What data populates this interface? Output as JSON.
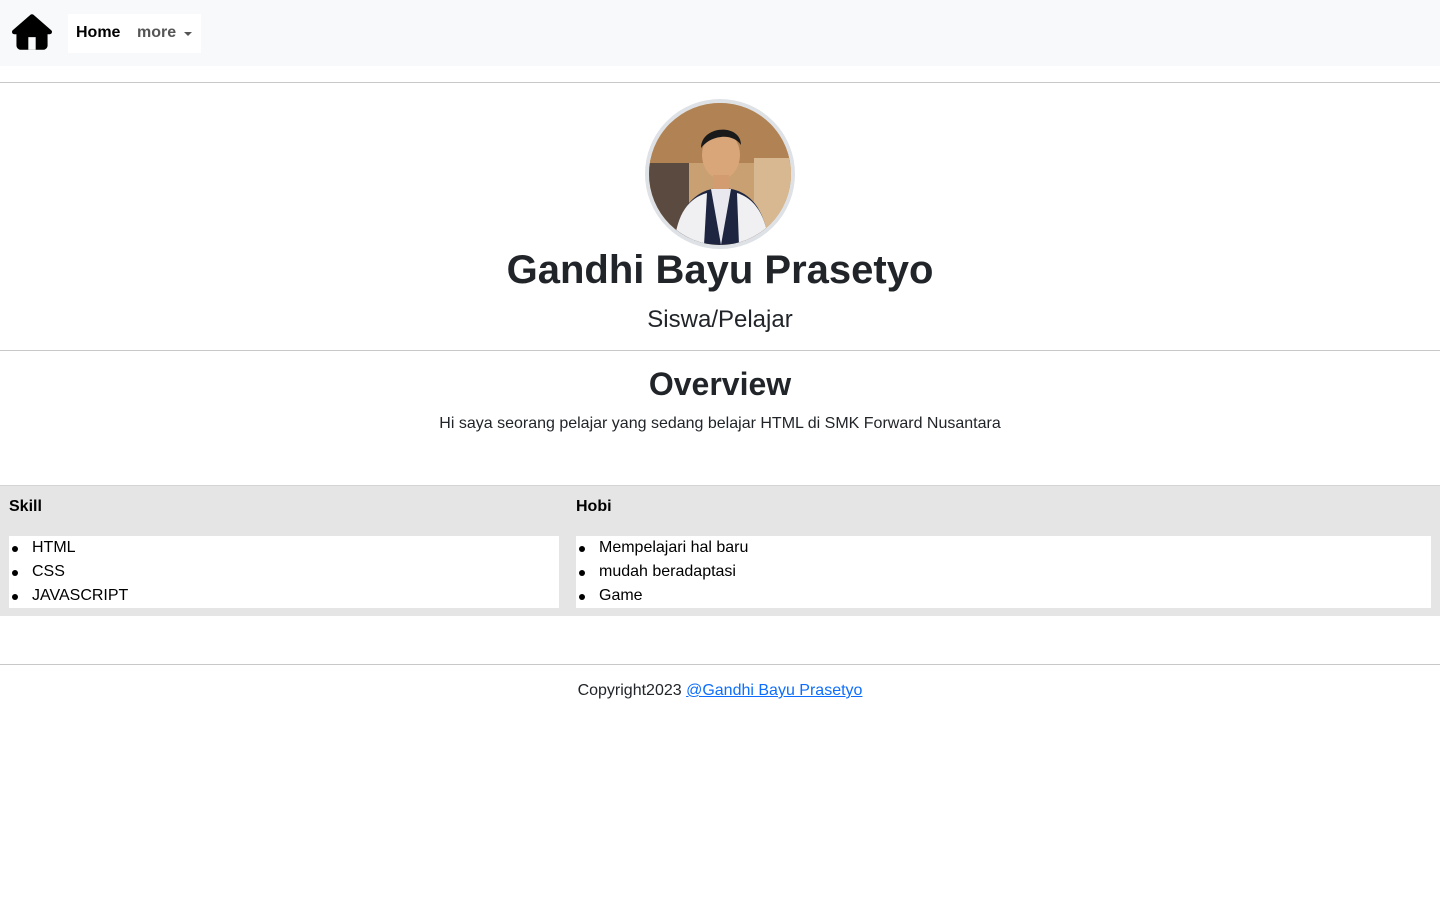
{
  "navbar": {
    "home_icon": "home-icon",
    "home_label": "Home",
    "more_label": "more"
  },
  "profile": {
    "name": "Gandhi Bayu Prasetyo",
    "role": "Siswa/Pelajar"
  },
  "overview": {
    "title": "Overview",
    "text": "Hi saya seorang pelajar yang sedang belajar HTML di SMK Forward Nusantara"
  },
  "table": {
    "headers": [
      "Skill",
      "Hobi"
    ],
    "skills": [
      "HTML",
      "CSS",
      "JAVASCRIPT"
    ],
    "hobbies": [
      "Mempelajari hal baru",
      "mudah beradaptasi",
      "Game"
    ]
  },
  "footer": {
    "text": "Copyright2023",
    "link": "@Gandhi Bayu Prasetyo"
  },
  "colors": {
    "navbar_bg": "#f8f9fa",
    "table_bg": "#e5e5e5",
    "link": "#0d6efd"
  }
}
